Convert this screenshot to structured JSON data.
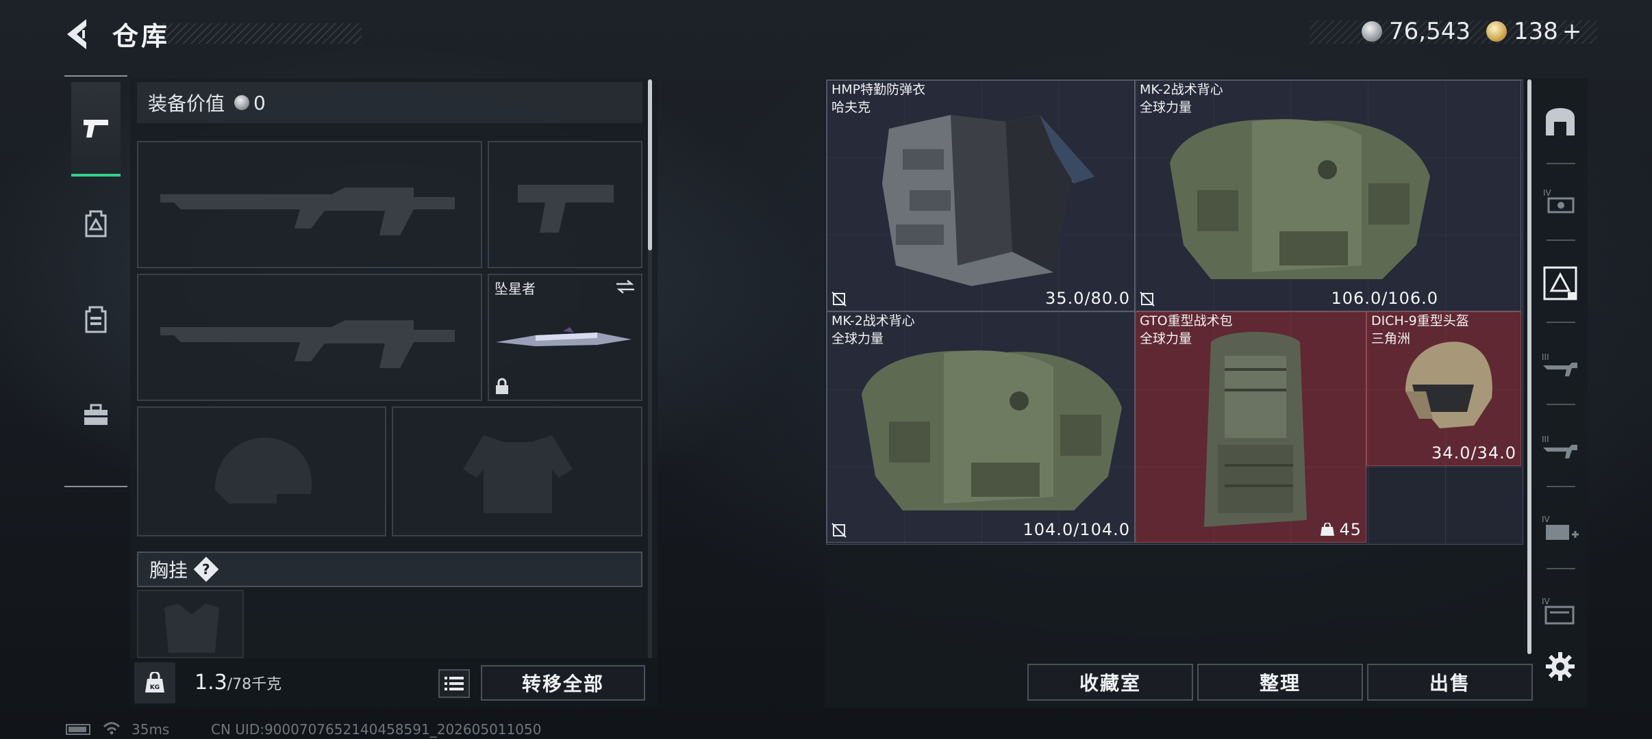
{
  "header": {
    "title": "仓库",
    "currency_silver": "76,543",
    "currency_gold": "138",
    "currency_gold_plus": "+"
  },
  "left_tabs": [
    {
      "icon": "pistol-icon",
      "active": true
    },
    {
      "icon": "backpack-icon",
      "active": false
    },
    {
      "icon": "vest-icon",
      "active": false
    },
    {
      "icon": "toolbox-icon",
      "active": false
    }
  ],
  "equipment": {
    "value_label": "装备价值",
    "value": "0",
    "melee_slot_name": "坠星者",
    "chest_label": "胸挂",
    "help_glyph": "?"
  },
  "bottom_left": {
    "weight_current": "1.3",
    "weight_max": "/78千克",
    "transfer_all": "转移全部"
  },
  "inventory_items": [
    {
      "name": "HMP特勤防弹衣",
      "brand": "哈夫克",
      "durability": "35.0/80.0",
      "no_repair": true
    },
    {
      "name": "MK-2战术背心",
      "brand": "全球力量",
      "durability": "106.0/106.0",
      "no_repair": true
    },
    {
      "name": "MK-2战术背心",
      "brand": "全球力量",
      "durability": "104.0/104.0",
      "no_repair": true
    },
    {
      "name": "GTO重型战术包",
      "brand": "全球力量",
      "durability": "45",
      "no_repair": false
    },
    {
      "name": "DICH-9重型头盔",
      "brand": "三角洲",
      "durability": "34.0/34.0",
      "no_repair": false
    }
  ],
  "bottom_right": {
    "collection_room": "收藏室",
    "organize": "整理",
    "sell": "出售"
  },
  "status_bar": {
    "ping": "35ms",
    "uid": "CN UID:9000707652140458591_202605011050"
  },
  "colors": {
    "accent_green": "#2fd18a",
    "item_red": "#782a32",
    "grid_bg": "#232734"
  }
}
